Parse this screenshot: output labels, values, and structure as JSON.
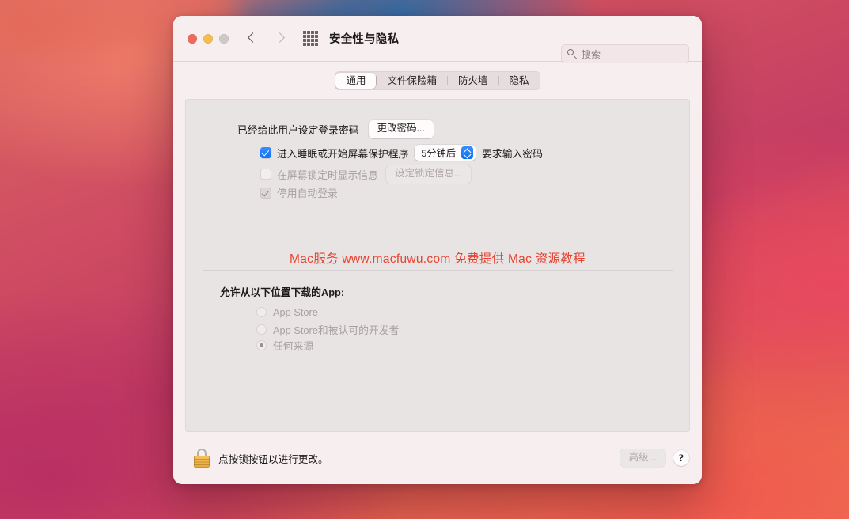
{
  "window": {
    "title": "安全性与隐私",
    "traffic_lights": {
      "close": "close-button",
      "minimize": "minimize-button",
      "zoom": "zoom-button",
      "close_color": "#EC6A5E",
      "minimize_color": "#F4BD4F",
      "zoom_color": "#CDC9C8"
    },
    "nav": {
      "back": "back-chevron",
      "forward": "forward-chevron"
    },
    "show_all_icon": "grid-icon",
    "search": {
      "placeholder": "搜索",
      "value": "",
      "icon": "search-icon"
    }
  },
  "tabs": [
    {
      "label": "通用",
      "active": true
    },
    {
      "label": "文件保险箱",
      "active": false
    },
    {
      "label": "防火墙",
      "active": false
    },
    {
      "label": "隐私",
      "active": false
    }
  ],
  "general": {
    "password_status": "已经给此用户设定登录密码",
    "change_password_button": "更改密码...",
    "require_password": {
      "label": "进入睡眠或开始屏幕保护程序",
      "checked": true,
      "delay_value": "5分钟后",
      "suffix": "要求输入密码"
    },
    "show_message": {
      "label": "在屏幕锁定时显示信息",
      "checked": false,
      "button": "设定锁定信息...",
      "disabled": true
    },
    "disable_auto_login": {
      "label": "停用自动登录",
      "checked": true,
      "disabled": true
    }
  },
  "watermark": "Mac服务  www.macfuwu.com  免费提供 Mac 资源教程",
  "watermark_color": "#E8412F",
  "download": {
    "title": "允许从以下位置下载的App:",
    "options": [
      {
        "label": "App Store",
        "selected": false
      },
      {
        "label": "App Store和被认可的开发者",
        "selected": false
      },
      {
        "label": "任何来源",
        "selected": true
      }
    ]
  },
  "bottom": {
    "lock_icon": "lock-closed-icon",
    "lock_text": "点按锁按钮以进行更改。",
    "advanced_button": "高级...",
    "help_button": "?"
  }
}
